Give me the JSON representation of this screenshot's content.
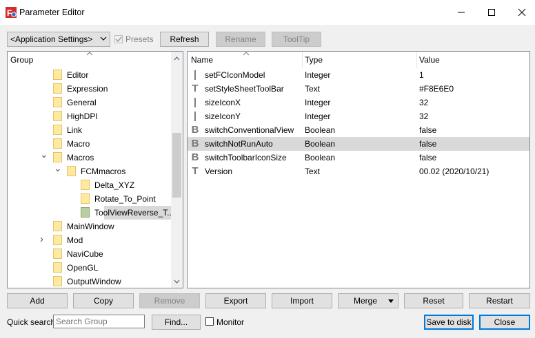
{
  "window": {
    "title": "Parameter Editor",
    "icon": "freecad-icon",
    "minimize_icon": "minimize-icon",
    "maximize_icon": "maximize-icon",
    "close_icon": "close-icon"
  },
  "toolbar": {
    "settings_combo": "<Application Settings>",
    "presets_label": "Presets",
    "presets_checked": true,
    "refresh": "Refresh",
    "rename": "Rename",
    "tooltip": "ToolTip"
  },
  "tree": {
    "header": "Group",
    "items": [
      {
        "label": "Editor",
        "expander": ""
      },
      {
        "label": "Expression",
        "expander": ""
      },
      {
        "label": "General",
        "expander": ""
      },
      {
        "label": "HighDPI",
        "expander": ""
      },
      {
        "label": "Link",
        "expander": ""
      },
      {
        "label": "Macro",
        "expander": ""
      },
      {
        "label": "Macros",
        "expander": "expanded"
      },
      {
        "label": "FCMmacros",
        "expander": "expanded"
      },
      {
        "label": "Delta_XYZ",
        "expander": ""
      },
      {
        "label": "Rotate_To_Point",
        "expander": ""
      },
      {
        "label": "ToolViewReverse_T...",
        "expander": "",
        "selected": true
      },
      {
        "label": "MainWindow",
        "expander": ""
      },
      {
        "label": "Mod",
        "expander": "collapsed"
      },
      {
        "label": "NaviCube",
        "expander": ""
      },
      {
        "label": "OpenGL",
        "expander": ""
      },
      {
        "label": "OutputWindow",
        "expander": ""
      }
    ]
  },
  "params": {
    "headers": {
      "name": "Name",
      "type": "Type",
      "value": "Value"
    },
    "rows": [
      {
        "name": "setFCIconModel",
        "type": "Integer",
        "value": "1",
        "icon": "integer-icon"
      },
      {
        "name": "setStyleSheetToolBar",
        "type": "Text",
        "value": "#F8E6E0",
        "icon": "text-icon"
      },
      {
        "name": "sizeIconX",
        "type": "Integer",
        "value": "32",
        "icon": "integer-icon"
      },
      {
        "name": "sizeIconY",
        "type": "Integer",
        "value": "32",
        "icon": "integer-icon"
      },
      {
        "name": "switchConventionalView",
        "type": "Boolean",
        "value": "false",
        "icon": "boolean-icon"
      },
      {
        "name": "switchNotRunAuto",
        "type": "Boolean",
        "value": "false",
        "icon": "boolean-icon",
        "selected": true
      },
      {
        "name": "switchToolbarIconSize",
        "type": "Boolean",
        "value": "false",
        "icon": "boolean-icon"
      },
      {
        "name": "Version",
        "type": "Text",
        "value": "00.02 (2020/10/21)",
        "icon": "text-icon"
      }
    ]
  },
  "actions": {
    "add": "Add",
    "copy": "Copy",
    "remove": "Remove",
    "export": "Export",
    "import": "Import",
    "merge": "Merge",
    "reset": "Reset",
    "restart": "Restart"
  },
  "footer": {
    "quick_search_label": "Quick search",
    "search_placeholder": "Search Group",
    "find": "Find...",
    "monitor_label": "Monitor",
    "monitor_checked": false,
    "save": "Save to disk",
    "close": "Close"
  }
}
